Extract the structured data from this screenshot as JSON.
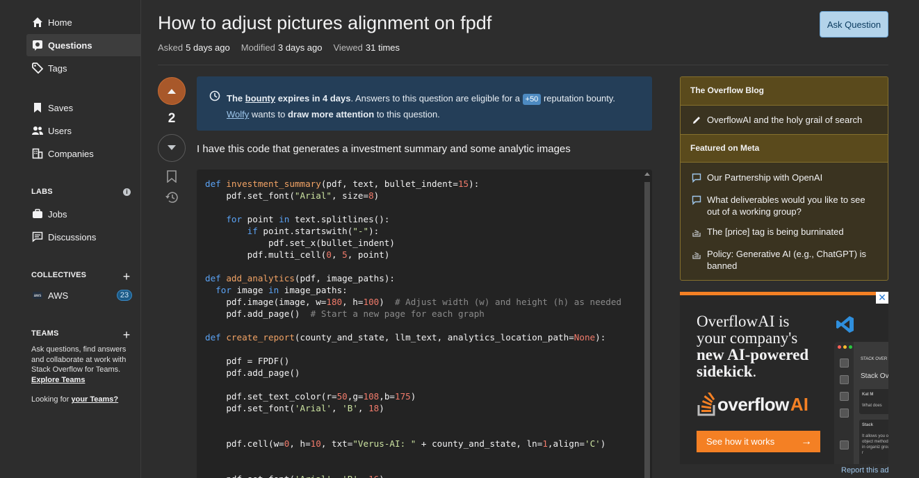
{
  "nav": {
    "home": "Home",
    "questions": "Questions",
    "tags": "Tags",
    "saves": "Saves",
    "users": "Users",
    "companies": "Companies"
  },
  "labs": {
    "title": "LABS",
    "jobs": "Jobs",
    "discussions": "Discussions"
  },
  "collectives": {
    "title": "COLLECTIVES",
    "aws": "AWS",
    "aws_count": "23"
  },
  "teams": {
    "title": "TEAMS",
    "description": "Ask questions, find answers and collaborate at work with Stack Overflow for Teams.",
    "explore_link": "Explore Teams",
    "looking_prefix": "Looking for",
    "looking_link": "your Teams?"
  },
  "question": {
    "title": "How to adjust pictures alignment on fpdf",
    "asked_label": "Asked",
    "asked_value": "5 days ago",
    "modified_label": "Modified",
    "modified_value": "3 days ago",
    "viewed_label": "Viewed",
    "viewed_value": "31 times",
    "ask_button": "Ask Question",
    "votes": "2",
    "body_intro": "I have this code that generates a investment summary and some analytic images"
  },
  "bounty": {
    "the": "The",
    "bounty_link": "bounty",
    "expires": "expires in 4 days",
    "text1": ". Answers to this question are eligible for a",
    "amount": "+50",
    "text2": "reputation bounty.",
    "user": "Wolfy",
    "text3": "wants to",
    "emphasis": "draw more attention",
    "text4": "to this question."
  },
  "sidebar_right": {
    "blog_title": "The Overflow Blog",
    "blog_items": [
      "OverflowAI and the holy grail of search"
    ],
    "meta_title": "Featured on Meta",
    "meta_items": [
      "Our Partnership with OpenAI",
      "What deliverables would you like to see out of a working group?",
      "The [price] tag is being burninated",
      "Policy: Generative AI (e.g., ChatGPT) is banned"
    ]
  },
  "ad": {
    "line1": "OverflowAI is",
    "line2": "your company's",
    "line3": "new AI-powered",
    "line4": "sidekick",
    "logo_word": "overflow",
    "logo_ai": "AI",
    "cta": "See how it works",
    "close": "✕",
    "report": "Report this ad",
    "panel_header": "STACK OVER",
    "panel_title": "Stack Ov",
    "panel_user": "Kat M",
    "panel_q": "What does",
    "panel_stack": "Stack",
    "panel_answer": "It allows you of an object methods o in organiz grouping r"
  },
  "colors": {
    "accent": "#f48024",
    "bounty_bg": "#243e58",
    "blog_bg": "#3a3320"
  }
}
